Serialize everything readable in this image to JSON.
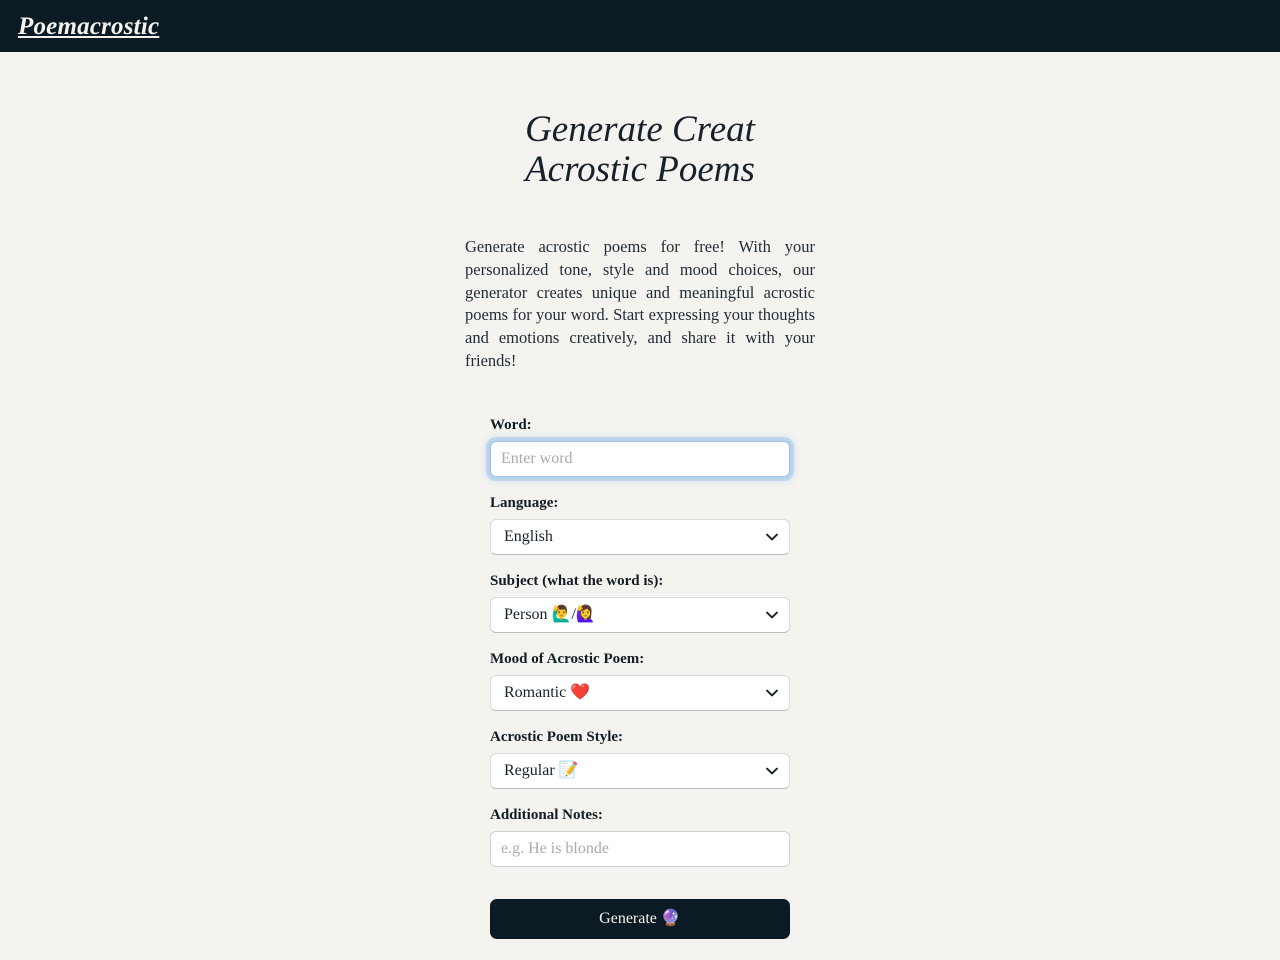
{
  "header": {
    "brand": "Poemacrostic"
  },
  "hero": {
    "title": "Generate Creat Acrostic Poems",
    "description": "Generate acrostic poems for free! With your personalized tone, style and mood choices, our generator creates unique and meaningful acrostic poems for your word. Start expressing your thoughts and emotions creatively, and share it with your friends!"
  },
  "form": {
    "word": {
      "label": "Word:",
      "placeholder": "Enter word",
      "value": ""
    },
    "language": {
      "label": "Language:",
      "selected": "English",
      "options": [
        "English"
      ]
    },
    "subject": {
      "label": "Subject (what the word is):",
      "selected": "Person 🙋‍♂️/🙋‍♀️",
      "options": [
        "Person 🙋‍♂️/🙋‍♀️"
      ]
    },
    "mood": {
      "label": "Mood of Acrostic Poem:",
      "selected": "Romantic ❤️",
      "options": [
        "Romantic ❤️"
      ]
    },
    "style": {
      "label": "Acrostic Poem Style:",
      "selected": "Regular 📝",
      "options": [
        "Regular 📝"
      ]
    },
    "notes": {
      "label": "Additional Notes:",
      "placeholder": "e.g. He is blonde",
      "value": ""
    },
    "generate_button": "Generate 🔮"
  },
  "colors": {
    "header_bg": "#0b1a23",
    "page_bg": "#f4f3ef",
    "text": "#16212b",
    "focus_ring": "#9fc3ea",
    "button_bg": "#0b1a23"
  }
}
